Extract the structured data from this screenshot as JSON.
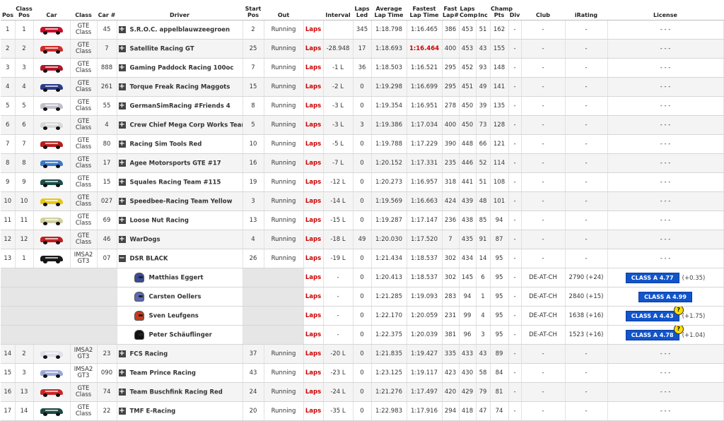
{
  "headers": {
    "pos": "Pos",
    "class_pos": "Class Pos",
    "car": "Car",
    "class": "Class",
    "car_num": "Car #",
    "driver": "Driver",
    "start_pos": "Start Pos",
    "out": "Out",
    "interval": "Interval",
    "laps_led": "Laps Led",
    "avg_lap": "Average Lap Time",
    "fastest_lap": "Fastest Lap Time",
    "fast_lap_num": "Fast Lap#",
    "laps_comp": "Laps Comp",
    "inc": "Inc",
    "champ_pts": "Champ Pts",
    "div": "Div",
    "club": "Club",
    "irating": "iRating",
    "license": "License"
  },
  "rows": [
    {
      "type": "team",
      "pos": "1",
      "cpos": "1",
      "car_color": "#c8102e",
      "class": "GTE Class",
      "num": "45",
      "name": "S.R.O.C. appelblauwzeegroen",
      "start": "2",
      "out": "Running",
      "laps": "Laps",
      "interval": "",
      "led": "345",
      "avg": "1:18.798",
      "fast": "1:16.465",
      "fastnum": "386",
      "comp": "453",
      "inc": "51",
      "pts": "162",
      "div": "-",
      "club": "-",
      "irating": "-",
      "license": "- - -"
    },
    {
      "type": "team",
      "pos": "2",
      "cpos": "2",
      "car_color": "#d42a2a",
      "class": "GTE Class",
      "num": "7",
      "name": "Satellite Racing GT",
      "start": "25",
      "out": "Running",
      "laps": "Laps",
      "interval": "-28.948",
      "led": "17",
      "avg": "1:18.693",
      "fast": "1:16.464",
      "fast_best": true,
      "fastnum": "400",
      "comp": "453",
      "inc": "43",
      "pts": "155",
      "div": "-",
      "club": "-",
      "irating": "-",
      "license": "- - -"
    },
    {
      "type": "team",
      "pos": "3",
      "cpos": "3",
      "car_color": "#b0162a",
      "class": "GTE Class",
      "num": "888",
      "name": "Gaming Paddock Racing 100oc",
      "start": "7",
      "out": "Running",
      "laps": "Laps",
      "interval": "-1 L",
      "led": "36",
      "avg": "1:18.503",
      "fast": "1:16.521",
      "fastnum": "295",
      "comp": "452",
      "inc": "93",
      "pts": "148",
      "div": "-",
      "club": "-",
      "irating": "-",
      "license": "- - -"
    },
    {
      "type": "team",
      "pos": "4",
      "cpos": "4",
      "car_color": "#2a3a8c",
      "class": "GTE Class",
      "num": "261",
      "name": "Torque Freak Racing Maggots",
      "start": "15",
      "out": "Running",
      "laps": "Laps",
      "interval": "-2 L",
      "led": "0",
      "avg": "1:19.298",
      "fast": "1:16.699",
      "fastnum": "295",
      "comp": "451",
      "inc": "49",
      "pts": "141",
      "div": "-",
      "club": "-",
      "irating": "-",
      "license": "- - -"
    },
    {
      "type": "team",
      "pos": "5",
      "cpos": "5",
      "car_color": "#c0c0c8",
      "class": "GTE Class",
      "num": "55",
      "name": "GermanSimRacing #Friends 4",
      "start": "8",
      "out": "Running",
      "laps": "Laps",
      "interval": "-3 L",
      "led": "0",
      "avg": "1:19.354",
      "fast": "1:16.951",
      "fastnum": "278",
      "comp": "450",
      "inc": "39",
      "pts": "135",
      "div": "-",
      "club": "-",
      "irating": "-",
      "license": "- - -"
    },
    {
      "type": "team",
      "pos": "6",
      "cpos": "6",
      "car_color": "#d8d8d8",
      "class": "GTE Class",
      "num": "4",
      "name": "Crew Chief Mega Corp Works Team",
      "start": "5",
      "out": "Running",
      "laps": "Laps",
      "interval": "-3 L",
      "led": "3",
      "avg": "1:19.386",
      "fast": "1:17.034",
      "fastnum": "400",
      "comp": "450",
      "inc": "73",
      "pts": "128",
      "div": "-",
      "club": "-",
      "irating": "-",
      "license": "- - -"
    },
    {
      "type": "team",
      "pos": "7",
      "cpos": "7",
      "car_color": "#b81c1c",
      "class": "GTE Class",
      "num": "80",
      "name": "Racing Sim Tools Red",
      "start": "10",
      "out": "Running",
      "laps": "Laps",
      "interval": "-5 L",
      "led": "0",
      "avg": "1:19.788",
      "fast": "1:17.229",
      "fastnum": "390",
      "comp": "448",
      "inc": "66",
      "pts": "121",
      "div": "-",
      "club": "-",
      "irating": "-",
      "license": "- - -"
    },
    {
      "type": "team",
      "pos": "8",
      "cpos": "8",
      "car_color": "#3a7acc",
      "class": "GTE Class",
      "num": "17",
      "name": "Agee Motorsports GTE #17",
      "start": "16",
      "out": "Running",
      "laps": "Laps",
      "interval": "-7 L",
      "led": "0",
      "avg": "1:20.152",
      "fast": "1:17.331",
      "fastnum": "235",
      "comp": "446",
      "inc": "52",
      "pts": "114",
      "div": "-",
      "club": "-",
      "irating": "-",
      "license": "- - -"
    },
    {
      "type": "team",
      "pos": "9",
      "cpos": "9",
      "car_color": "#1e4e4a",
      "class": "GTE Class",
      "num": "15",
      "name": "Squales Racing Team #115",
      "start": "19",
      "out": "Running",
      "laps": "Laps",
      "interval": "-12 L",
      "led": "0",
      "avg": "1:20.273",
      "fast": "1:16.957",
      "fastnum": "318",
      "comp": "441",
      "inc": "51",
      "pts": "108",
      "div": "-",
      "club": "-",
      "irating": "-",
      "license": "- - -"
    },
    {
      "type": "team",
      "pos": "10",
      "cpos": "10",
      "car_color": "#e8c810",
      "class": "GTE Class",
      "num": "027",
      "name": "Speedbee-Racing Team Yellow",
      "start": "3",
      "out": "Running",
      "laps": "Laps",
      "interval": "-14 L",
      "led": "0",
      "avg": "1:19.569",
      "fast": "1:16.663",
      "fastnum": "424",
      "comp": "439",
      "inc": "48",
      "pts": "101",
      "div": "-",
      "club": "-",
      "irating": "-",
      "license": "- - -"
    },
    {
      "type": "team",
      "pos": "11",
      "cpos": "11",
      "car_color": "#d0d0a0",
      "class": "GTE Class",
      "num": "69",
      "name": "Loose Nut Racing",
      "start": "13",
      "out": "Running",
      "laps": "Laps",
      "interval": "-15 L",
      "led": "0",
      "avg": "1:19.287",
      "fast": "1:17.147",
      "fastnum": "236",
      "comp": "438",
      "inc": "85",
      "pts": "94",
      "div": "-",
      "club": "-",
      "irating": "-",
      "license": "- - -"
    },
    {
      "type": "team",
      "pos": "12",
      "cpos": "12",
      "car_color": "#c02020",
      "class": "GTE Class",
      "num": "46",
      "name": "WarDogs",
      "start": "4",
      "out": "Running",
      "laps": "Laps",
      "interval": "-18 L",
      "led": "49",
      "avg": "1:20.030",
      "fast": "1:17.520",
      "fastnum": "7",
      "comp": "435",
      "inc": "91",
      "pts": "87",
      "div": "-",
      "club": "-",
      "irating": "-",
      "license": "- - -"
    },
    {
      "type": "team",
      "expanded": true,
      "pos": "13",
      "cpos": "1",
      "car_color": "#1a1a1a",
      "class": "IMSA2 GT3",
      "num": "07",
      "name": "DSR BLACK",
      "start": "26",
      "out": "Running",
      "laps": "Laps",
      "interval": "-19 L",
      "led": "0",
      "avg": "1:21.434",
      "fast": "1:18.537",
      "fastnum": "302",
      "comp": "434",
      "inc": "14",
      "pts": "95",
      "div": "-",
      "club": "-",
      "irating": "-",
      "license": "- - -"
    },
    {
      "type": "driver",
      "helmet": "#3a4a9a",
      "name": "Matthias Eggert",
      "laps": "Laps",
      "interval": "-",
      "led": "0",
      "avg": "1:20.413",
      "fast": "1:18.537",
      "fastnum": "302",
      "comp": "145",
      "inc": "6",
      "pts": "95",
      "div": "-",
      "club": "DE-AT-CH",
      "irating": "2790 (+24)",
      "license": "CLASS A 4.77",
      "lic_change": "(+0.35)",
      "q": false
    },
    {
      "type": "driver",
      "helmet": "#5a6ab0",
      "name": "Carsten Oellers",
      "laps": "Laps",
      "interval": "-",
      "led": "0",
      "avg": "1:21.285",
      "fast": "1:19.093",
      "fastnum": "283",
      "comp": "94",
      "inc": "1",
      "pts": "95",
      "div": "-",
      "club": "DE-AT-CH",
      "irating": "2840 (+15)",
      "license": "CLASS A 4.99",
      "lic_change": "",
      "q": false
    },
    {
      "type": "driver",
      "helmet": "#c83a1a",
      "name": "Sven Leufgens",
      "laps": "Laps",
      "interval": "-",
      "led": "0",
      "avg": "1:22.170",
      "fast": "1:20.059",
      "fastnum": "231",
      "comp": "99",
      "inc": "4",
      "pts": "95",
      "div": "-",
      "club": "DE-AT-CH",
      "irating": "1638 (+16)",
      "license": "CLASS A 4.43",
      "lic_change": "(+1.75)",
      "q": true
    },
    {
      "type": "driver",
      "helmet": "#111111",
      "name": "Peter Schäuflinger",
      "laps": "Laps",
      "interval": "-",
      "led": "0",
      "avg": "1:22.375",
      "fast": "1:20.039",
      "fastnum": "381",
      "comp": "96",
      "inc": "3",
      "pts": "95",
      "div": "-",
      "club": "DE-AT-CH",
      "irating": "1523 (+16)",
      "license": "CLASS A 4.78",
      "lic_change": "(+1.04)",
      "q": true
    },
    {
      "type": "team",
      "pos": "14",
      "cpos": "2",
      "car_color": "#e0e0e8",
      "class": "IMSA2 GT3",
      "num": "23",
      "name": "FCS Racing",
      "start": "37",
      "out": "Running",
      "laps": "Laps",
      "interval": "-20 L",
      "led": "0",
      "avg": "1:21.835",
      "fast": "1:19.427",
      "fastnum": "335",
      "comp": "433",
      "inc": "43",
      "pts": "89",
      "div": "-",
      "club": "-",
      "irating": "-",
      "license": "- - -"
    },
    {
      "type": "team",
      "pos": "15",
      "cpos": "3",
      "car_color": "#9aa8d8",
      "class": "IMSA2 GT3",
      "num": "090",
      "name": "Team Prince Racing",
      "start": "43",
      "out": "Running",
      "laps": "Laps",
      "interval": "-23 L",
      "led": "0",
      "avg": "1:23.125",
      "fast": "1:19.117",
      "fastnum": "423",
      "comp": "430",
      "inc": "58",
      "pts": "84",
      "div": "-",
      "club": "-",
      "irating": "-",
      "license": "- - -"
    },
    {
      "type": "team",
      "pos": "16",
      "cpos": "13",
      "car_color": "#c82828",
      "class": "GTE Class",
      "num": "74",
      "name": "Team Buschfink Racing Red",
      "start": "24",
      "out": "Running",
      "laps": "Laps",
      "interval": "-24 L",
      "led": "0",
      "avg": "1:21.276",
      "fast": "1:17.497",
      "fastnum": "420",
      "comp": "429",
      "inc": "79",
      "pts": "81",
      "div": "-",
      "club": "-",
      "irating": "-",
      "license": "- - -"
    },
    {
      "type": "team",
      "pos": "17",
      "cpos": "14",
      "car_color": "#1c4a44",
      "class": "GTE Class",
      "num": "22",
      "name": "TMF E-Racing",
      "start": "20",
      "out": "Running",
      "laps": "Laps",
      "interval": "-35 L",
      "led": "0",
      "avg": "1:22.983",
      "fast": "1:17.916",
      "fastnum": "294",
      "comp": "418",
      "inc": "47",
      "pts": "74",
      "div": "-",
      "club": "-",
      "irating": "-",
      "license": "- - -"
    }
  ]
}
